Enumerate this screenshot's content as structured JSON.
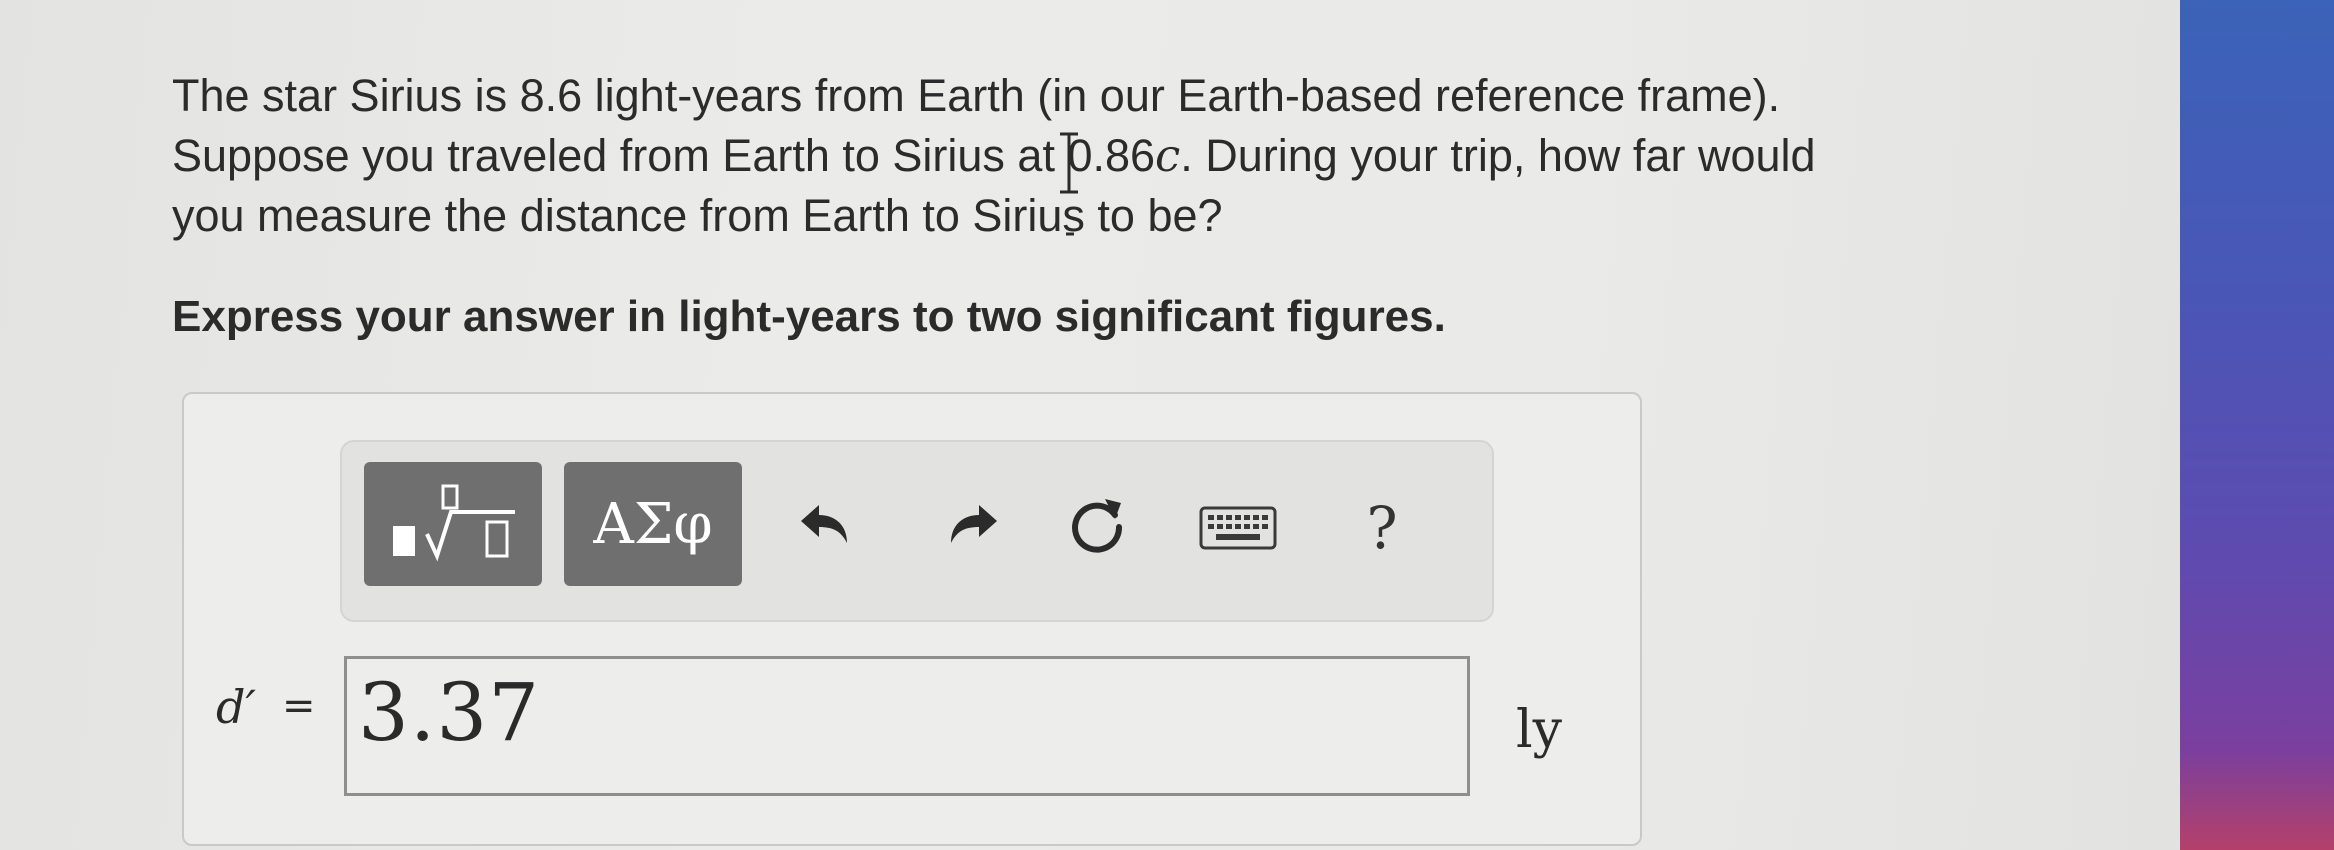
{
  "question": {
    "line1": "The star Sirius is 8.6 light-years from Earth (in our Earth-based reference frame).",
    "line2_pre": "Suppose you traveled from Earth to Sirius at 0.86",
    "line2_var": "c",
    "line2_post": ". During your trip, how far would",
    "line3": "you measure the distance from Earth to Sirius to be?"
  },
  "instruction": "Express your answer in light-years to two significant figures.",
  "toolbar": {
    "greek_label": "ΑΣφ",
    "help_label": "?",
    "icons": [
      "templates-icon",
      "undo-icon",
      "redo-icon",
      "reset-icon",
      "keyboard-icon",
      "help-icon"
    ]
  },
  "answer": {
    "variable": "d′",
    "equals": "=",
    "value": "3.37",
    "unit": "ly"
  },
  "colors": {
    "toolbar_button": "#6f6f6f",
    "page_background": "#eaeae8",
    "desktop_edge": "#4a56b6"
  }
}
